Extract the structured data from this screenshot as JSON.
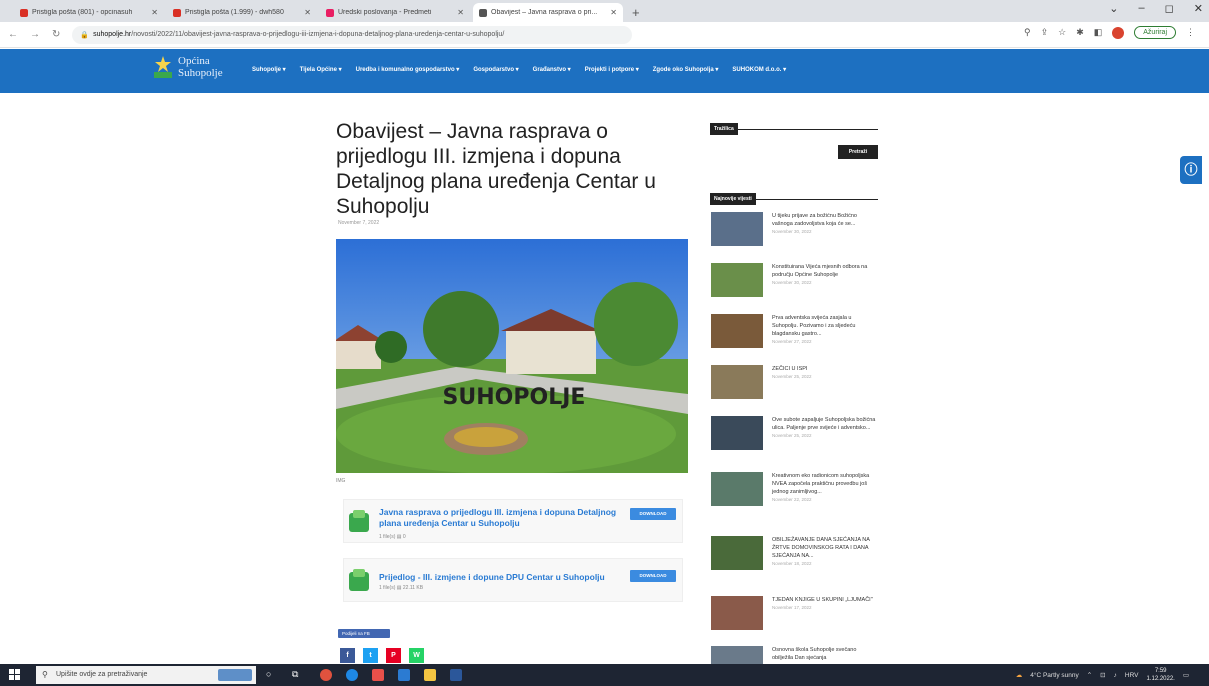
{
  "browser": {
    "tabs": [
      {
        "title": "Pristigla pošta (801) - opcinasuh",
        "color": "#d93025",
        "active": false
      },
      {
        "title": "Pristigla pošta (1.999) - dwh580",
        "color": "#d93025",
        "active": false
      },
      {
        "title": "Uredski poslovanja - Predmeti",
        "color": "#e91e63",
        "active": false
      },
      {
        "title": "Obavijest – Javna rasprava o pri...",
        "color": "#555555",
        "active": true
      }
    ],
    "new_tab": "+",
    "window_controls": [
      "⌄",
      "–",
      "◻",
      "✕"
    ],
    "url_domain": "suhopolje.hr",
    "url_path": "/novosti/2022/11/obavijest-javna-rasprava-o-prijedlogu-iii-izmjena-i-dopuna-detaljnog-plana-uredenja-centar-u-suhopolju/",
    "update_label": "Ažuriraj"
  },
  "site": {
    "logo_line1": "Općina",
    "logo_line2": "Suhopolje",
    "brand_color": "#1d70c1",
    "menu": [
      "Suhopolje ▾",
      "Tijela Općine ▾",
      "Uredba i komunalno gospodarstvo ▾",
      "Gospodarstvo ▾",
      "Građanstvo ▾",
      "Projekti i potpore ▾",
      "Zgode oko Suhopolja ▾",
      "SUHOKOM d.o.o. ▾"
    ]
  },
  "article": {
    "title": "Obavijest – Javna rasprava o prijedlogu III. izmjena i dopuna Detaljnog plana uređenja Centar u Suhopolju",
    "date": "November 7, 2022",
    "image_caption": "IMG",
    "hero_sign": "SUHOPOLJE",
    "downloads": [
      {
        "title": "Javna rasprava o prijedlogu III. izmjena i dopuna Detaljnog plana uređenja Centar u Suhopolju",
        "meta": "1 file(s)    ▤ 0",
        "button": "DOWNLOAD"
      },
      {
        "title": "Prijedlog - III. izmjene i dopune DPU Centar u Suhopolju",
        "meta": "1 file(s)    ▤ 22.11 KB",
        "button": "DOWNLOAD"
      }
    ],
    "fb_share": "Podijeli na FB",
    "share_buttons": [
      {
        "label": "f",
        "color": "#3b5998"
      },
      {
        "label": "t",
        "color": "#1da1f2"
      },
      {
        "label": "P",
        "color": "#e60023"
      },
      {
        "label": "W",
        "color": "#25d366"
      }
    ]
  },
  "sidebar": {
    "search_heading": "Tražilica",
    "search_button": "Pretraži",
    "latest_heading": "Najnovije vijesti",
    "news": [
      {
        "title": "U tijeku prijave za božićnu Božićno vašnoga zadovoljstva koja će se...",
        "date": "November 30, 2022"
      },
      {
        "title": "Konstituirana Vijeća mjesnih odbora na području Općine Suhopolje",
        "date": "November 30, 2022"
      },
      {
        "title": "Prva adventska svijeća zasjala u Suhopolju. Pozivamo i za sljedeću blagdansku gastro...",
        "date": "November 27, 2022"
      },
      {
        "title": "ZEČICI U ISPI",
        "date": "November 25, 2022"
      },
      {
        "title": "Ove subote zapaljuje Suhopoljska božićna ulica. Paljenje prve svijeće i adventsko...",
        "date": "November 25, 2022"
      },
      {
        "title": "Kreativnom eko radionicom suhopoljska NVEA započela praktičnu provedbu još jednog zanimljivog...",
        "date": "November 22, 2022"
      },
      {
        "title": "OBILJEŽAVANJE DANA SJEĆANJA NA ŽRTVE DOMOVINSKOG RATA I DANA SJEĆANJA NA...",
        "date": "November 18, 2022"
      },
      {
        "title": "TJEDAN KNJIGE U SKUPINI „LJUMAČI\"",
        "date": "November 17, 2022"
      },
      {
        "title": "Osnovna škola Suhopolje svečano obilježila Dan sjećanja",
        "date": ""
      }
    ]
  },
  "taskbar": {
    "search_placeholder": "Upišite ovdje za pretraživanje",
    "weather": "4°C  Partly sunny",
    "lang": "HRV",
    "time": "7:59",
    "date": "1.12.2022."
  }
}
